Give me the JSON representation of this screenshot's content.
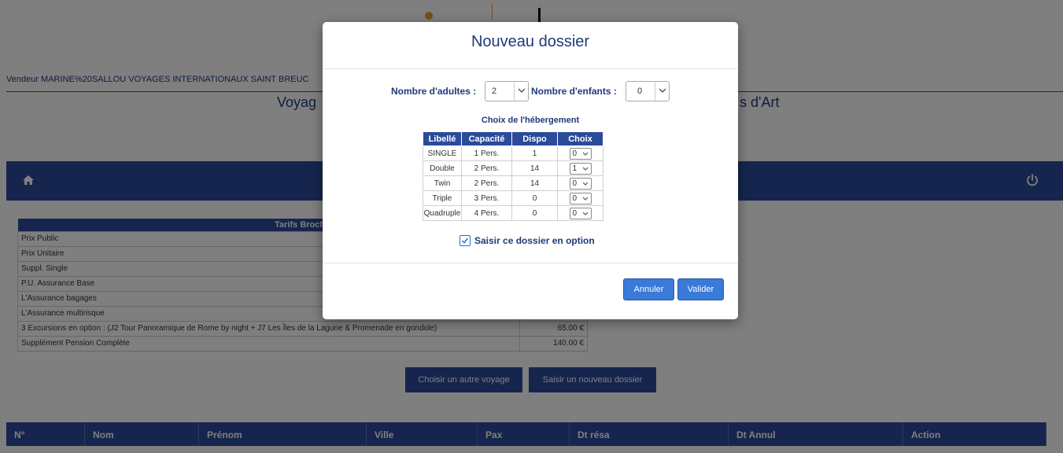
{
  "vendor_text": "Vendeur MARINE%20SALLOU VOYAGES INTERNATIONAUX SAINT BREUC",
  "trip_title_left": "Voyag",
  "trip_title_right": "s d'Art",
  "tarifs": {
    "header": "Tarifs Brochu",
    "rows": [
      {
        "label": "Prix Public",
        "price": ""
      },
      {
        "label": "Prix Unitaire",
        "price": ""
      },
      {
        "label": "Suppl. Single",
        "price": ""
      },
      {
        "label": "P.U. Assurance Base",
        "price": ""
      },
      {
        "label": "L'Assurance bagages",
        "price": ""
      },
      {
        "label": "L'Assurance multirisque",
        "price": ""
      },
      {
        "label": "3 Excursions en option : (J2 Tour Panoramique de Rome by night + J7 Les Îles de la Lagune & Promenade en gondole)",
        "price": "65.00 €"
      },
      {
        "label": "Supplément Pension Complète",
        "price": "140.00 €"
      }
    ]
  },
  "buttons": {
    "choose_other": "Choisir un autre voyage",
    "new_dossier": "Saisir un nouveau dossier"
  },
  "dossiers_columns": [
    "N°",
    "Nom",
    "Prénom",
    "Ville",
    "Pax",
    "Dt résa",
    "Dt Annul",
    "Action"
  ],
  "modal": {
    "title": "Nouveau dossier",
    "adults_label": "Nombre d'adultes :",
    "adults_value": "2",
    "children_label": "Nombre d'enfants :",
    "children_value": "0",
    "hebergement_title": "Choix de l'hébergement",
    "heb_columns": [
      "Libellé",
      "Capacité",
      "Dispo",
      "Choix"
    ],
    "heb_rows": [
      {
        "libelle": "SINGLE",
        "capacite": "1 Pers.",
        "dispo": "1",
        "choix": "0"
      },
      {
        "libelle": "Double",
        "capacite": "2 Pers.",
        "dispo": "14",
        "choix": "1"
      },
      {
        "libelle": "Twin",
        "capacite": "2 Pers.",
        "dispo": "14",
        "choix": "0"
      },
      {
        "libelle": "Triple",
        "capacite": "3 Pers.",
        "dispo": "0",
        "choix": "0"
      },
      {
        "libelle": "Quadruple",
        "capacite": "4 Pers.",
        "dispo": "0",
        "choix": "0"
      }
    ],
    "option_label": "Saisir ce dossier en option",
    "option_checked": true,
    "cancel_label": "Annuler",
    "ok_label": "Valider"
  },
  "colors": {
    "primary": "#2a4a9a",
    "button": "#3a7ad8",
    "title": "#1e3a7a"
  }
}
